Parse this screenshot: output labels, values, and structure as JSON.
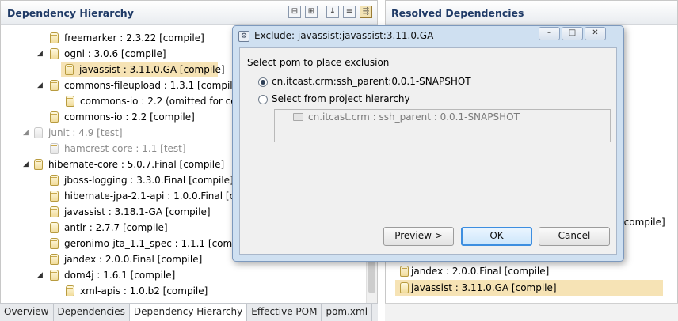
{
  "left_panel": {
    "title": "Dependency Hierarchy",
    "toolbar": [
      "collapse-all-icon",
      "expand-all-icon",
      "sort-az-icon",
      "show-groups-icon",
      "filter-icon"
    ],
    "rows": [
      {
        "label": "freemarker : 2.3.22 [compile]",
        "depth": 2,
        "muted": false
      },
      {
        "label": "ognl : 3.0.6 [compile]",
        "depth": 2,
        "muted": false,
        "expanded": true
      },
      {
        "label": "javassist : 3.11.0.GA [compile]",
        "depth": 3,
        "muted": false,
        "selected": true
      },
      {
        "label": "commons-fileupload : 1.3.1 [compile]",
        "depth": 2,
        "muted": false,
        "expanded": true
      },
      {
        "label": "commons-io : 2.2 (omitted for conflict with 2.2)",
        "depth": 3,
        "muted": false
      },
      {
        "label": "commons-io : 2.2 [compile]",
        "depth": 2,
        "muted": false
      },
      {
        "label": "junit : 4.9 [test]",
        "depth": 1,
        "muted": true,
        "expanded": true
      },
      {
        "label": "hamcrest-core : 1.1 [test]",
        "depth": 2,
        "muted": true
      },
      {
        "label": "hibernate-core : 5.0.7.Final [compile]",
        "depth": 1,
        "muted": false,
        "expanded": true
      },
      {
        "label": "jboss-logging : 3.3.0.Final [compile]",
        "depth": 2,
        "muted": false
      },
      {
        "label": "hibernate-jpa-2.1-api : 1.0.0.Final [compile]",
        "depth": 2,
        "muted": false
      },
      {
        "label": "javassist : 3.18.1-GA [compile]",
        "depth": 2,
        "muted": false
      },
      {
        "label": "antlr : 2.7.7 [compile]",
        "depth": 2,
        "muted": false
      },
      {
        "label": "geronimo-jta_1.1_spec : 1.1.1 [compile]",
        "depth": 2,
        "muted": false
      },
      {
        "label": "jandex : 2.0.0.Final [compile]",
        "depth": 2,
        "muted": false
      },
      {
        "label": "dom4j : 1.6.1 [compile]",
        "depth": 2,
        "muted": false,
        "expanded": true
      },
      {
        "label": "xml-apis : 1.0.b2 [compile]",
        "depth": 3,
        "muted": false
      }
    ]
  },
  "right_panel": {
    "title": "Resolved Dependencies",
    "partial_row": "[compile]",
    "rows": [
      {
        "label": "jandex : 2.0.0.Final [compile]",
        "selected": false
      },
      {
        "label": "javassist : 3.11.0.GA [compile]",
        "selected": true
      }
    ]
  },
  "tabs": [
    {
      "label": "Overview",
      "active": false
    },
    {
      "label": "Dependencies",
      "active": false
    },
    {
      "label": "Dependency Hierarchy",
      "active": true
    },
    {
      "label": "Effective POM",
      "active": false
    },
    {
      "label": "pom.xml",
      "active": false
    }
  ],
  "dialog": {
    "title": "Exclude: javassist:javassist:3.11.0.GA",
    "prompt": "Select pom to place exclusion",
    "option_pom": "cn.itcast.crm:ssh_parent:0.0.1-SNAPSHOT",
    "option_hierarchy": "Select from project hierarchy",
    "hierarchy_item": "cn.itcast.crm : ssh_parent : 0.0.1-SNAPSHOT",
    "preview_label": "Preview >",
    "ok_label": "OK",
    "cancel_label": "Cancel",
    "window_buttons": [
      "minimize-icon",
      "maximize-icon",
      "close-icon"
    ]
  }
}
